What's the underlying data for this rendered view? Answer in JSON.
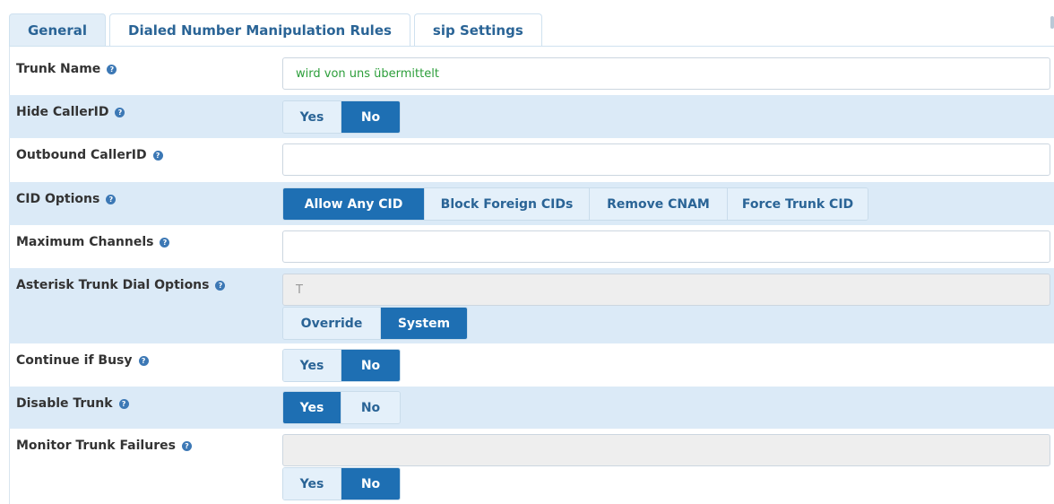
{
  "tabs": [
    {
      "label": "General",
      "active": true
    },
    {
      "label": "Dialed Number Manipulation Rules",
      "active": false
    },
    {
      "label": "sip Settings",
      "active": false
    }
  ],
  "fields": {
    "trunk_name": {
      "label": "Trunk Name",
      "value": "wird von uns übermittelt"
    },
    "hide_callerid": {
      "label": "Hide CallerID",
      "options": [
        "Yes",
        "No"
      ],
      "selected": "No"
    },
    "outbound_callerid": {
      "label": "Outbound CallerID",
      "value": ""
    },
    "cid_options": {
      "label": "CID Options",
      "options": [
        "Allow Any CID",
        "Block Foreign CIDs",
        "Remove CNAM",
        "Force Trunk CID"
      ],
      "selected": "Allow Any CID"
    },
    "max_channels": {
      "label": "Maximum Channels",
      "value": ""
    },
    "dial_options": {
      "label": "Asterisk Trunk Dial Options",
      "value": "T",
      "options": [
        "Override",
        "System"
      ],
      "selected": "System"
    },
    "continue_busy": {
      "label": "Continue if Busy",
      "options": [
        "Yes",
        "No"
      ],
      "selected": "No"
    },
    "disable_trunk": {
      "label": "Disable Trunk",
      "options": [
        "Yes",
        "No"
      ],
      "selected": "Yes"
    },
    "monitor_failures": {
      "label": "Monitor Trunk Failures",
      "value": "",
      "options": [
        "Yes",
        "No"
      ],
      "selected": "No"
    }
  },
  "help_icon": "question-circle-icon",
  "colors": {
    "accent": "#1e6fb3",
    "row_shade": "#dbeaf7",
    "value_green": "#2c9e3a"
  }
}
